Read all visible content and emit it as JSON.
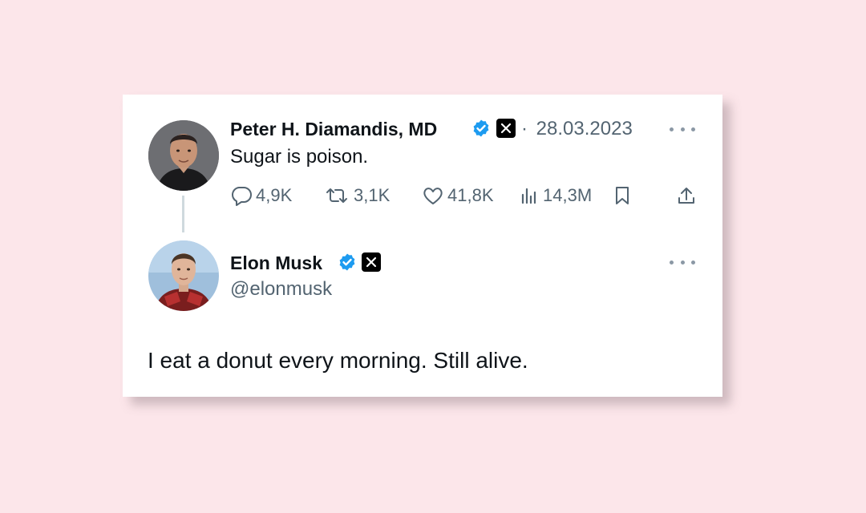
{
  "parent_tweet": {
    "author_name": "Peter H. Diamandis, MD",
    "separator": "·",
    "date": "28.03.2023",
    "text": "Sugar is poison.",
    "stats": {
      "replies": "4,9K",
      "retweets": "3,1K",
      "likes": "41,8K",
      "views": "14,3M"
    },
    "icons": [
      "verified-badge-icon",
      "x-logo-icon",
      "more-icon",
      "reply-icon",
      "retweet-icon",
      "like-icon",
      "views-icon",
      "bookmark-icon",
      "share-icon"
    ]
  },
  "reply_tweet": {
    "author_name": "Elon Musk",
    "handle": "@elonmusk",
    "text": "I eat a donut every morning. Still alive.",
    "icons": [
      "verified-badge-icon",
      "x-logo-icon",
      "more-icon"
    ]
  },
  "colors": {
    "page_background": "#fce6ea",
    "card_background": "#ffffff",
    "verified_blue": "#1d9bf0",
    "primary_text": "#0f1419",
    "secondary_text": "#536471"
  }
}
